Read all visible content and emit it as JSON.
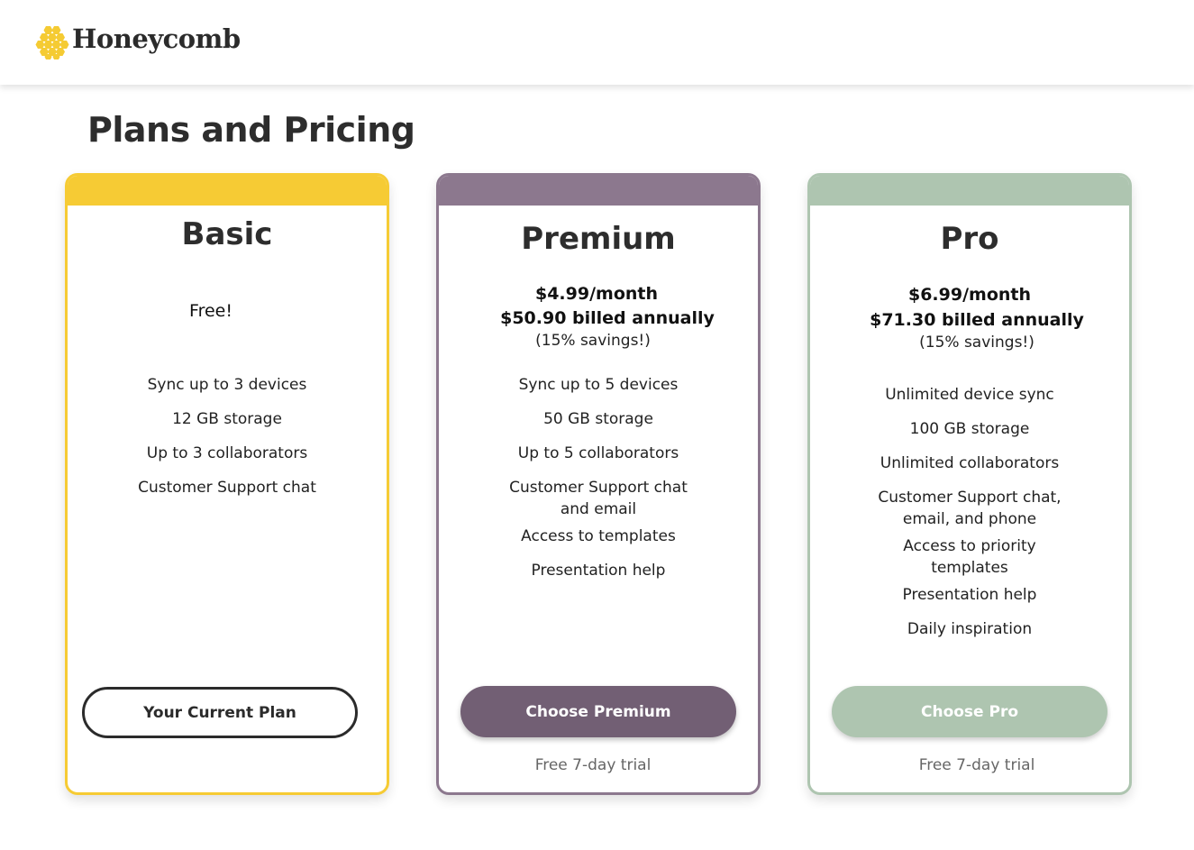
{
  "brand": {
    "name": "Honeycomb",
    "icon": "honeycomb-logo-icon",
    "color": "#F5CB33"
  },
  "page": {
    "title": "Plans and Pricing"
  },
  "colors": {
    "basic": "#F6CB34",
    "premium": "#8C788E",
    "premium_button": "#725F74",
    "pro": "#AEC5B0"
  },
  "plans": {
    "basic": {
      "name": "Basic",
      "price": "Free!",
      "features": [
        "Sync up to 3 devices",
        "12 GB storage",
        "Up to 3 collaborators",
        "Customer Support chat"
      ],
      "button": "Your Current Plan"
    },
    "premium": {
      "name": "Premium",
      "monthly": "$4.99/month",
      "annual": "$50.90 billed annually",
      "savings": "(15% savings!)",
      "features": [
        "Sync up to 5 devices",
        "50 GB storage",
        "Up to 5 collaborators",
        "Customer Support chat and email",
        "Access to templates",
        "Presentation help"
      ],
      "button": "Choose Premium",
      "trial": "Free 7-day trial"
    },
    "pro": {
      "name": "Pro",
      "monthly": "$6.99/month",
      "annual": "$71.30 billed annually",
      "savings": "(15% savings!)",
      "features": [
        "Unlimited device sync",
        "100 GB storage",
        "Unlimited collaborators",
        "Customer Support chat, email, and phone",
        "Access to priority templates",
        "Presentation help",
        "Daily inspiration"
      ],
      "button": "Choose Pro",
      "trial": "Free 7-day trial"
    }
  }
}
